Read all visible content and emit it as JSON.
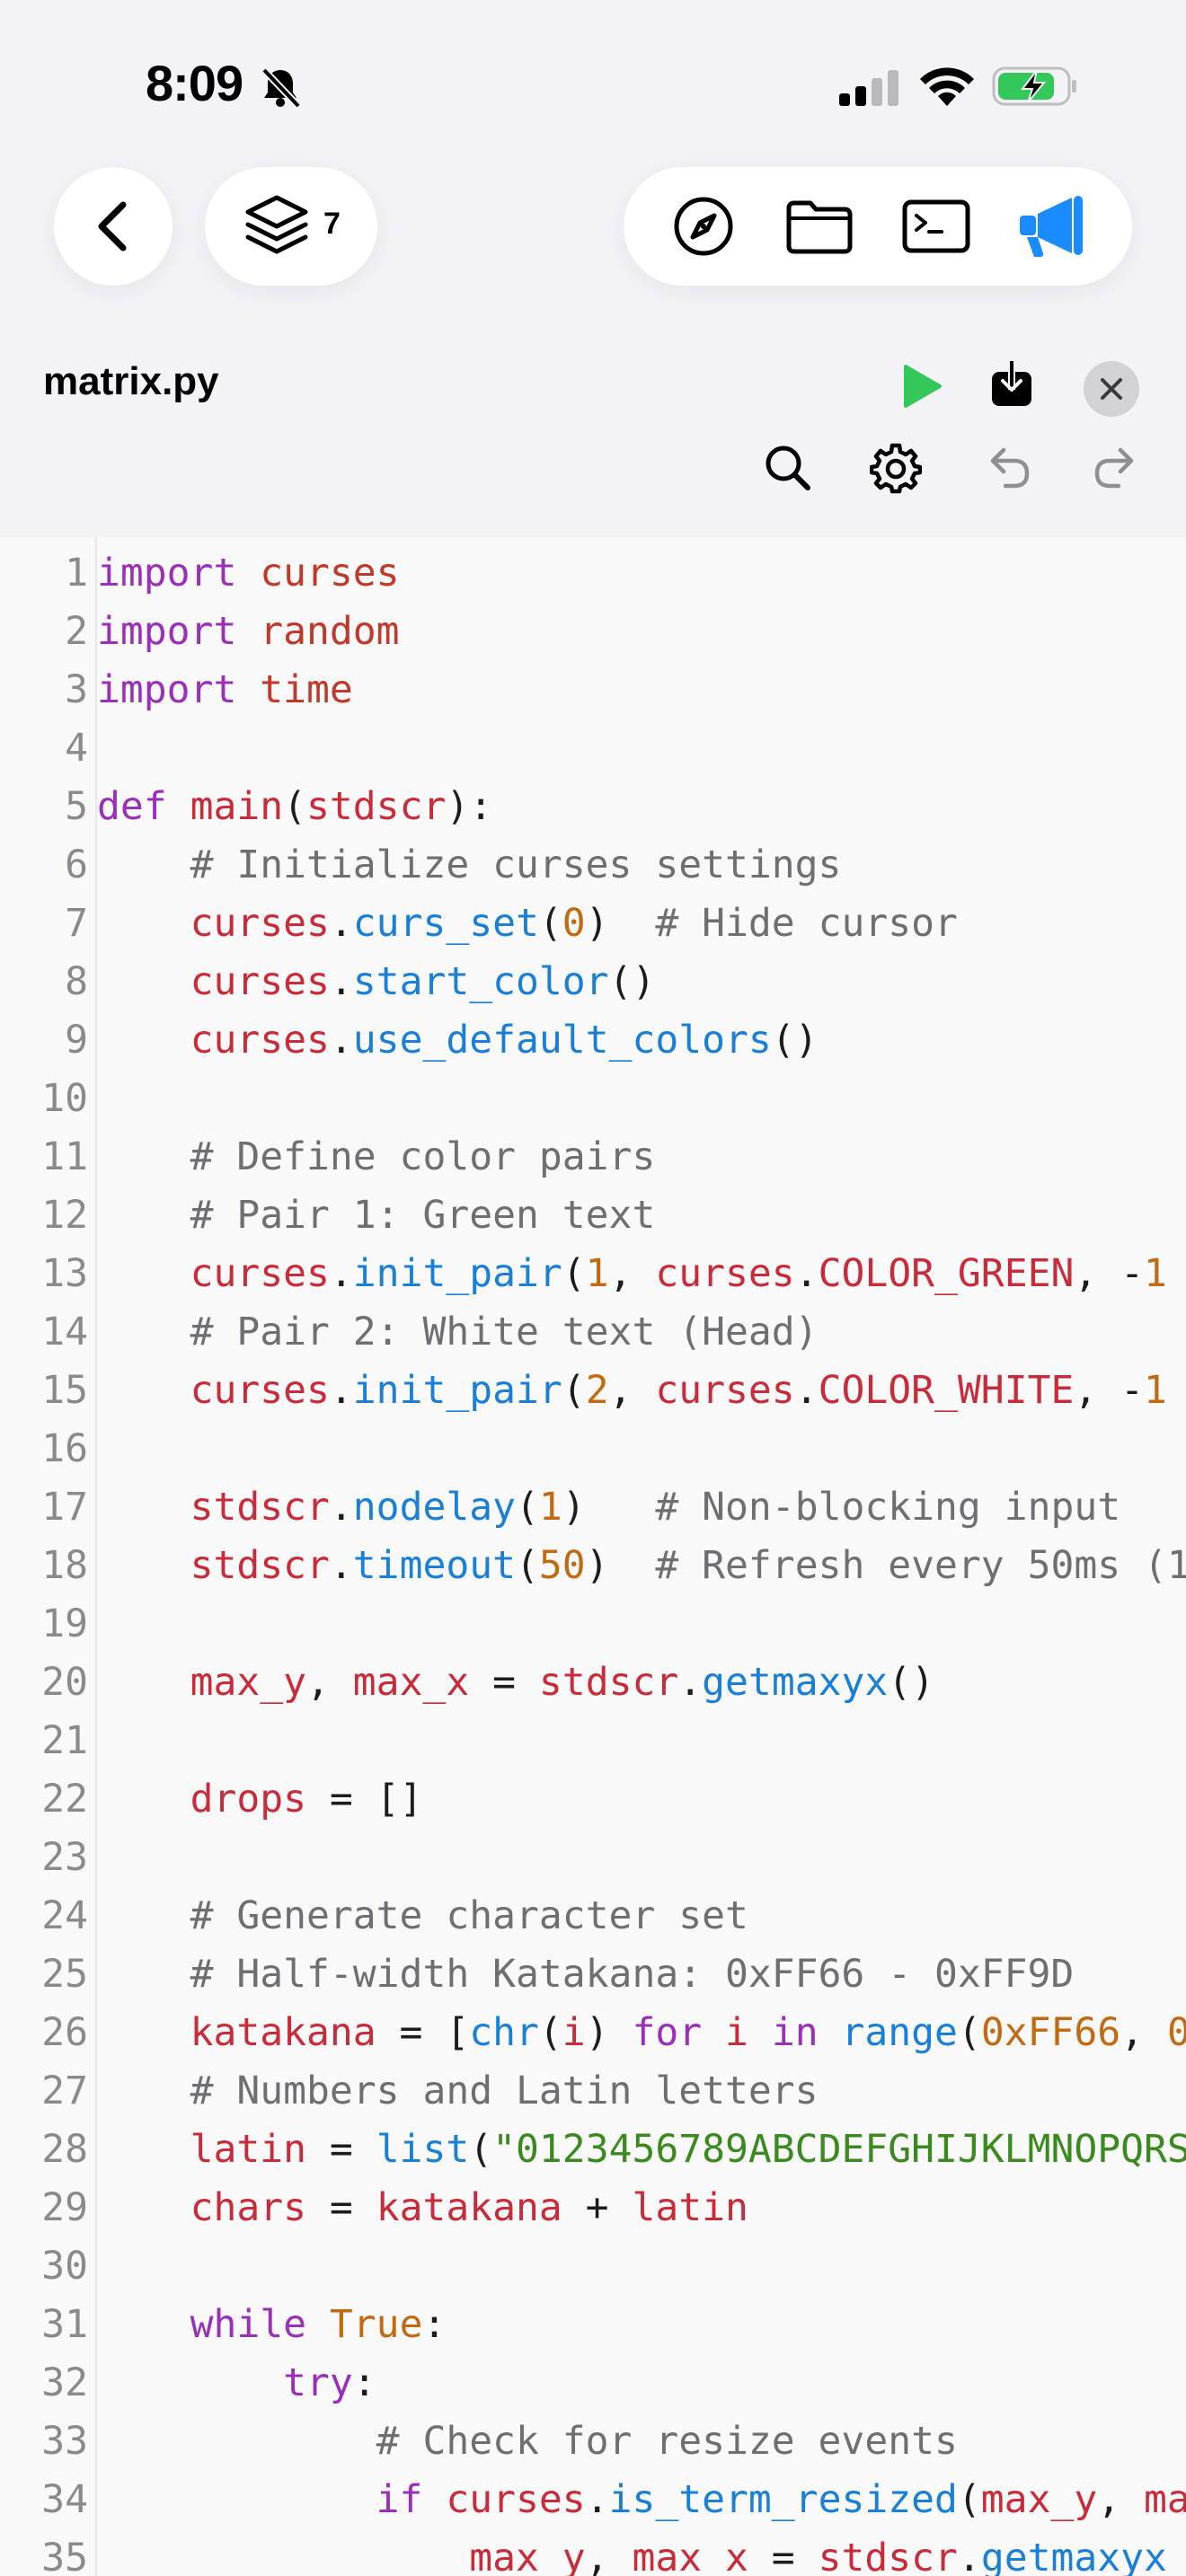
{
  "status_bar": {
    "time": "8:09"
  },
  "toolbar": {
    "tabs_count": "7",
    "icons": [
      "chevron-left-icon",
      "layers-icon",
      "compass-icon",
      "folder-icon",
      "terminal-icon",
      "megaphone-icon"
    ],
    "accent_color": "#1a8cff"
  },
  "editor": {
    "file_name": "matrix.py",
    "run_color": "#34c759"
  },
  "code": [
    {
      "n": "1",
      "tokens": [
        [
          "kw",
          "import"
        ],
        [
          "op",
          " "
        ],
        [
          "mod",
          "curses"
        ]
      ]
    },
    {
      "n": "2",
      "tokens": [
        [
          "kw",
          "import"
        ],
        [
          "op",
          " "
        ],
        [
          "mod",
          "random"
        ]
      ]
    },
    {
      "n": "3",
      "tokens": [
        [
          "kw",
          "import"
        ],
        [
          "op",
          " "
        ],
        [
          "mod",
          "time"
        ]
      ]
    },
    {
      "n": "4",
      "tokens": []
    },
    {
      "n": "5",
      "tokens": [
        [
          "kw",
          "def"
        ],
        [
          "op",
          " "
        ],
        [
          "var",
          "main"
        ],
        [
          "op",
          "("
        ],
        [
          "var",
          "stdscr"
        ],
        [
          "op",
          "):"
        ]
      ]
    },
    {
      "n": "6",
      "tokens": [
        [
          "op",
          "    "
        ],
        [
          "com",
          "# Initialize curses settings"
        ]
      ]
    },
    {
      "n": "7",
      "tokens": [
        [
          "op",
          "    "
        ],
        [
          "var",
          "curses"
        ],
        [
          "op",
          "."
        ],
        [
          "fn",
          "curs_set"
        ],
        [
          "op",
          "("
        ],
        [
          "num",
          "0"
        ],
        [
          "op",
          ")  "
        ],
        [
          "com",
          "# Hide cursor"
        ]
      ]
    },
    {
      "n": "8",
      "tokens": [
        [
          "op",
          "    "
        ],
        [
          "var",
          "curses"
        ],
        [
          "op",
          "."
        ],
        [
          "fn",
          "start_color"
        ],
        [
          "op",
          "()"
        ]
      ]
    },
    {
      "n": "9",
      "tokens": [
        [
          "op",
          "    "
        ],
        [
          "var",
          "curses"
        ],
        [
          "op",
          "."
        ],
        [
          "fn",
          "use_default_colors"
        ],
        [
          "op",
          "()"
        ]
      ]
    },
    {
      "n": "10",
      "tokens": []
    },
    {
      "n": "11",
      "tokens": [
        [
          "op",
          "    "
        ],
        [
          "com",
          "# Define color pairs"
        ]
      ]
    },
    {
      "n": "12",
      "tokens": [
        [
          "op",
          "    "
        ],
        [
          "com",
          "# Pair 1: Green text"
        ]
      ]
    },
    {
      "n": "13",
      "tokens": [
        [
          "op",
          "    "
        ],
        [
          "var",
          "curses"
        ],
        [
          "op",
          "."
        ],
        [
          "fn",
          "init_pair"
        ],
        [
          "op",
          "("
        ],
        [
          "num",
          "1"
        ],
        [
          "op",
          ", "
        ],
        [
          "var",
          "curses"
        ],
        [
          "op",
          "."
        ],
        [
          "var",
          "COLOR_GREEN"
        ],
        [
          "op",
          ", -"
        ],
        [
          "num",
          "1"
        ]
      ]
    },
    {
      "n": "14",
      "tokens": [
        [
          "op",
          "    "
        ],
        [
          "com",
          "# Pair 2: White text (Head)"
        ]
      ]
    },
    {
      "n": "15",
      "tokens": [
        [
          "op",
          "    "
        ],
        [
          "var",
          "curses"
        ],
        [
          "op",
          "."
        ],
        [
          "fn",
          "init_pair"
        ],
        [
          "op",
          "("
        ],
        [
          "num",
          "2"
        ],
        [
          "op",
          ", "
        ],
        [
          "var",
          "curses"
        ],
        [
          "op",
          "."
        ],
        [
          "var",
          "COLOR_WHITE"
        ],
        [
          "op",
          ", -"
        ],
        [
          "num",
          "1"
        ]
      ]
    },
    {
      "n": "16",
      "tokens": []
    },
    {
      "n": "17",
      "tokens": [
        [
          "op",
          "    "
        ],
        [
          "var",
          "stdscr"
        ],
        [
          "op",
          "."
        ],
        [
          "fn",
          "nodelay"
        ],
        [
          "op",
          "("
        ],
        [
          "num",
          "1"
        ],
        [
          "op",
          ")   "
        ],
        [
          "com",
          "# Non-blocking input"
        ]
      ]
    },
    {
      "n": "18",
      "tokens": [
        [
          "op",
          "    "
        ],
        [
          "var",
          "stdscr"
        ],
        [
          "op",
          "."
        ],
        [
          "fn",
          "timeout"
        ],
        [
          "op",
          "("
        ],
        [
          "num",
          "50"
        ],
        [
          "op",
          ")  "
        ],
        [
          "com",
          "# Refresh every 50ms (1"
        ]
      ]
    },
    {
      "n": "19",
      "tokens": []
    },
    {
      "n": "20",
      "tokens": [
        [
          "op",
          "    "
        ],
        [
          "var",
          "max_y"
        ],
        [
          "op",
          ", "
        ],
        [
          "var",
          "max_x"
        ],
        [
          "op",
          " = "
        ],
        [
          "var",
          "stdscr"
        ],
        [
          "op",
          "."
        ],
        [
          "fn",
          "getmaxyx"
        ],
        [
          "op",
          "()"
        ]
      ]
    },
    {
      "n": "21",
      "tokens": []
    },
    {
      "n": "22",
      "tokens": [
        [
          "op",
          "    "
        ],
        [
          "var",
          "drops"
        ],
        [
          "op",
          " = []"
        ]
      ]
    },
    {
      "n": "23",
      "tokens": []
    },
    {
      "n": "24",
      "tokens": [
        [
          "op",
          "    "
        ],
        [
          "com",
          "# Generate character set"
        ]
      ]
    },
    {
      "n": "25",
      "tokens": [
        [
          "op",
          "    "
        ],
        [
          "com",
          "# Half-width Katakana: 0xFF66 - 0xFF9D"
        ]
      ]
    },
    {
      "n": "26",
      "tokens": [
        [
          "op",
          "    "
        ],
        [
          "var",
          "katakana"
        ],
        [
          "op",
          " = ["
        ],
        [
          "fn",
          "chr"
        ],
        [
          "op",
          "("
        ],
        [
          "var",
          "i"
        ],
        [
          "op",
          ") "
        ],
        [
          "kw",
          "for"
        ],
        [
          "op",
          " "
        ],
        [
          "var",
          "i"
        ],
        [
          "op",
          " "
        ],
        [
          "kw",
          "in"
        ],
        [
          "op",
          " "
        ],
        [
          "fn",
          "range"
        ],
        [
          "op",
          "("
        ],
        [
          "num",
          "0xFF66"
        ],
        [
          "op",
          ", "
        ],
        [
          "num",
          "0"
        ]
      ]
    },
    {
      "n": "27",
      "tokens": [
        [
          "op",
          "    "
        ],
        [
          "com",
          "# Numbers and Latin letters"
        ]
      ]
    },
    {
      "n": "28",
      "tokens": [
        [
          "op",
          "    "
        ],
        [
          "var",
          "latin"
        ],
        [
          "op",
          " = "
        ],
        [
          "fn",
          "list"
        ],
        [
          "op",
          "("
        ],
        [
          "str",
          "\"0123456789ABCDEFGHIJKLMNOPQRS"
        ]
      ]
    },
    {
      "n": "29",
      "tokens": [
        [
          "op",
          "    "
        ],
        [
          "var",
          "chars"
        ],
        [
          "op",
          " = "
        ],
        [
          "var",
          "katakana"
        ],
        [
          "op",
          " + "
        ],
        [
          "var",
          "latin"
        ]
      ]
    },
    {
      "n": "30",
      "tokens": []
    },
    {
      "n": "31",
      "tokens": [
        [
          "op",
          "    "
        ],
        [
          "kw",
          "while"
        ],
        [
          "op",
          " "
        ],
        [
          "num",
          "True"
        ],
        [
          "op",
          ":"
        ]
      ]
    },
    {
      "n": "32",
      "tokens": [
        [
          "op",
          "        "
        ],
        [
          "kw",
          "try"
        ],
        [
          "op",
          ":"
        ]
      ]
    },
    {
      "n": "33",
      "tokens": [
        [
          "op",
          "            "
        ],
        [
          "com",
          "# Check for resize events"
        ]
      ]
    },
    {
      "n": "34",
      "tokens": [
        [
          "op",
          "            "
        ],
        [
          "kw",
          "if"
        ],
        [
          "op",
          " "
        ],
        [
          "var",
          "curses"
        ],
        [
          "op",
          "."
        ],
        [
          "fn",
          "is_term_resized"
        ],
        [
          "op",
          "("
        ],
        [
          "var",
          "max_y"
        ],
        [
          "op",
          ", "
        ],
        [
          "var",
          "ma"
        ]
      ]
    },
    {
      "n": "35",
      "tokens": [
        [
          "op",
          "                "
        ],
        [
          "var",
          "max_y"
        ],
        [
          "op",
          ", "
        ],
        [
          "var",
          "max_x"
        ],
        [
          "op",
          " = "
        ],
        [
          "var",
          "stdscr"
        ],
        [
          "op",
          "."
        ],
        [
          "fn",
          "getmaxyx"
        ]
      ]
    }
  ]
}
